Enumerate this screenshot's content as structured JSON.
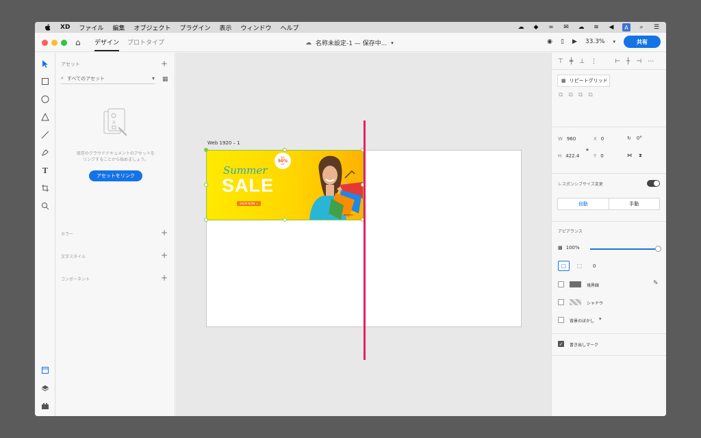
{
  "menubar": {
    "items": [
      "XD",
      "ファイル",
      "編集",
      "オブジェクト",
      "プラグイン",
      "表示",
      "ウィンドウ",
      "ヘルプ"
    ],
    "status_icons": [
      "cloud-sync-icon",
      "dropbox-icon",
      "creative-cloud-icon",
      "mail-alert-icon",
      "cloud-upload-icon",
      "wifi-icon",
      "volume-icon",
      "input-method-icon",
      "search-icon",
      "list-icon"
    ],
    "input_method": "A"
  },
  "titlebar": {
    "tabs": [
      {
        "label": "デザイン",
        "active": true
      },
      {
        "label": "プロトタイプ",
        "active": false
      }
    ],
    "doc_title": "名称未設定-1 — 保存中...",
    "zoom": "33.3%",
    "share_label": "共有"
  },
  "assets": {
    "header": "アセット",
    "search_placeholder": "すべてのアセット",
    "empty_text": "既存のクラウドドキュメントのアセットを\nリンクすることから始めましょう。",
    "link_button": "アセットをリンク",
    "sections": [
      "カラー",
      "文字スタイル",
      "コンポーネント"
    ]
  },
  "canvas": {
    "artboard_label": "Web 1920 – 1",
    "banner": {
      "script_text": "Summer",
      "headline": "SALE",
      "cta": "SHOP NOW >",
      "badge_top": "最大",
      "badge_value": "50%",
      "badge_bottom": "OFF",
      "credit": "#2334A5"
    }
  },
  "properties": {
    "repeat_grid": "リピートグリッド",
    "w_label": "W",
    "w_value": "960",
    "h_label": "H",
    "h_value": "422.4",
    "x_label": "X",
    "x_value": "0",
    "y_label": "Y",
    "y_value": "0",
    "rotation": "0°",
    "responsive_label": "レスポンシブサイズ変更",
    "responsive_on": true,
    "seg_auto": "自動",
    "seg_manual": "手動",
    "appearance_label": "アピアランス",
    "opacity": "100%",
    "opacity_fraction": 1.0,
    "corner_radius": "0",
    "border_label": "境界線",
    "shadow_label": "シャドウ",
    "bg_blur_label": "背景のぼかし",
    "export_label": "書き出しマーク",
    "export_checked": true,
    "border_color": "#6e6e6e"
  },
  "colors": {
    "accent": "#1473e6",
    "pink_guide": "#e91e63",
    "selection": "#8bc34a"
  }
}
